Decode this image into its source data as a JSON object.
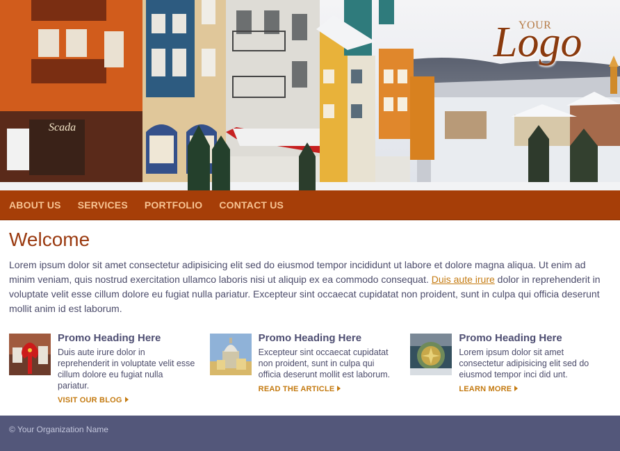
{
  "logo": {
    "small": "YOUR",
    "big": "Logo"
  },
  "nav": [
    {
      "label": "ABOUT US"
    },
    {
      "label": "SERVICES"
    },
    {
      "label": "PORTFOLIO"
    },
    {
      "label": "CONTACT US"
    }
  ],
  "main": {
    "title": "Welcome",
    "intro_before_link": "Lorem ipsum dolor sit amet consectetur adipisicing elit sed do eiusmod tempor incididunt ut labore et dolore magna aliqua. Ut enim ad minim veniam, quis nostrud exercitation ullamco laboris nisi ut aliquip ex ea commodo consequat. ",
    "intro_link": "Duis aute irure",
    "intro_after_link": " dolor in reprehenderit in voluptate velit esse cillum dolore eu fugiat nulla pariatur. Excepteur sint occaecat cupidatat non proident, sunt in culpa qui officia deserunt mollit anim id est laborum."
  },
  "promos": [
    {
      "heading": "Promo Heading Here",
      "text": "Duis aute irure dolor in reprehenderit in voluptate velit esse cillum dolore eu fugiat nulla pariatur.",
      "link": "VISIT OUR BLOG"
    },
    {
      "heading": "Promo Heading Here",
      "text": "Excepteur sint occaecat cupidatat non proident, sunt in culpa qui officia deserunt mollit est laborum.",
      "link": "READ THE ARTICLE"
    },
    {
      "heading": "Promo Heading Here",
      "text": "Lorem ipsum dolor sit amet consectetur adipisicing elit sed do eiusmod tempor inci did unt.",
      "link": "LEARN MORE"
    }
  ],
  "footer": {
    "copyright": "© Your Organization Name"
  },
  "colors": {
    "nav_bg": "#a63e08",
    "nav_text": "#f8c493",
    "heading": "#9a3a10",
    "link": "#c47a10",
    "footer_bg": "#53577a"
  },
  "icons": [
    "chevron-right-icon"
  ]
}
